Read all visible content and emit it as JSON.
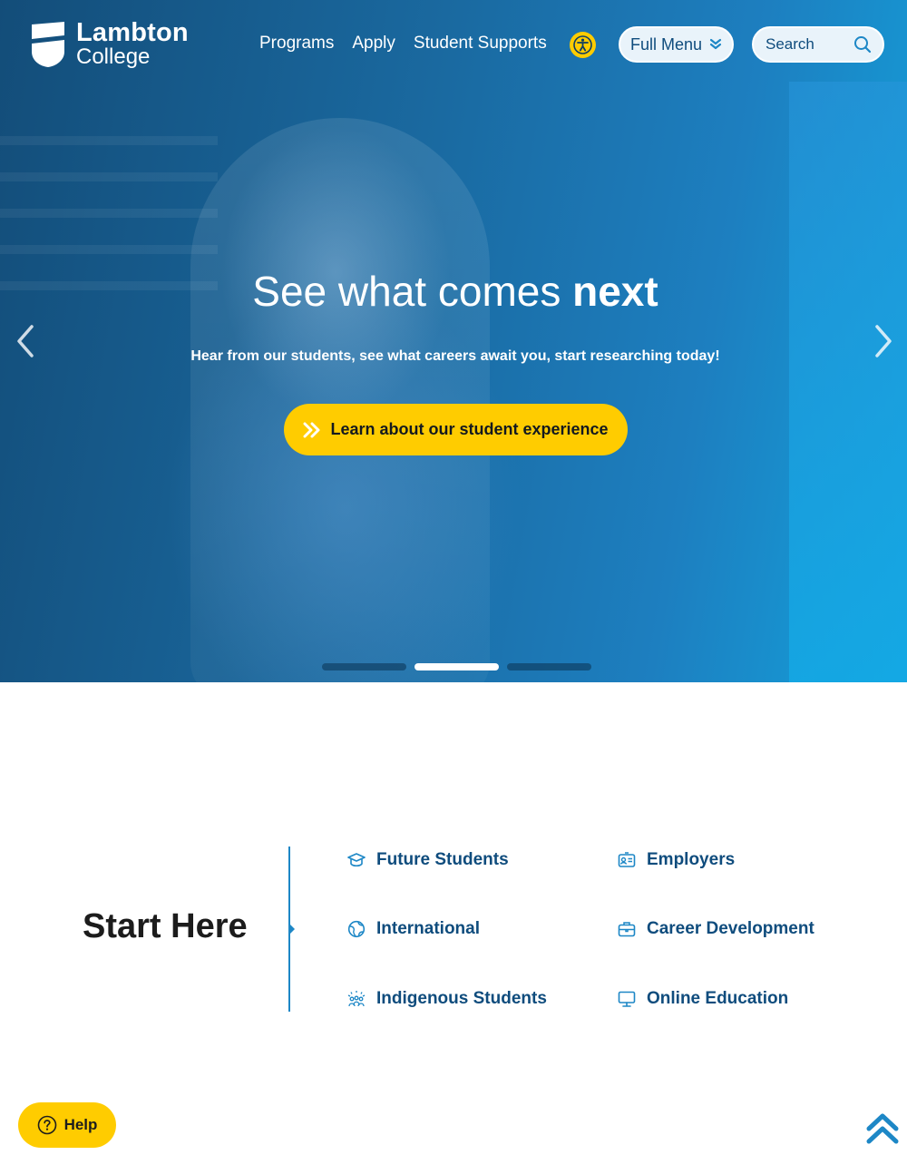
{
  "header": {
    "logo_line1": "Lambton",
    "logo_line2": "College",
    "nav": [
      "Programs",
      "Apply",
      "Student Supports"
    ],
    "accessibility_icon": "accessibility-icon",
    "full_menu_label": "Full Menu",
    "search_placeholder": "Search"
  },
  "hero": {
    "title_regular": "See what comes ",
    "title_bold": "next",
    "subtitle": "Hear from our students, see what careers await you, start researching today!",
    "cta_label": "Learn about our student experience",
    "slides": 3,
    "active_slide": 2
  },
  "start_here": {
    "title": "Start Here",
    "links": [
      {
        "label": "Future Students",
        "icon": "graduation-cap-icon"
      },
      {
        "label": "Employers",
        "icon": "id-card-icon"
      },
      {
        "label": "International",
        "icon": "globe-icon"
      },
      {
        "label": "Career Development",
        "icon": "briefcase-icon"
      },
      {
        "label": "Indigenous Students",
        "icon": "people-icon"
      },
      {
        "label": "Online Education",
        "icon": "monitor-icon"
      }
    ]
  },
  "floating": {
    "help_label": "Help"
  },
  "colors": {
    "brand_blue": "#0f4c7d",
    "accent_yellow": "#ffcc00",
    "link_blue": "#1d87c6"
  }
}
